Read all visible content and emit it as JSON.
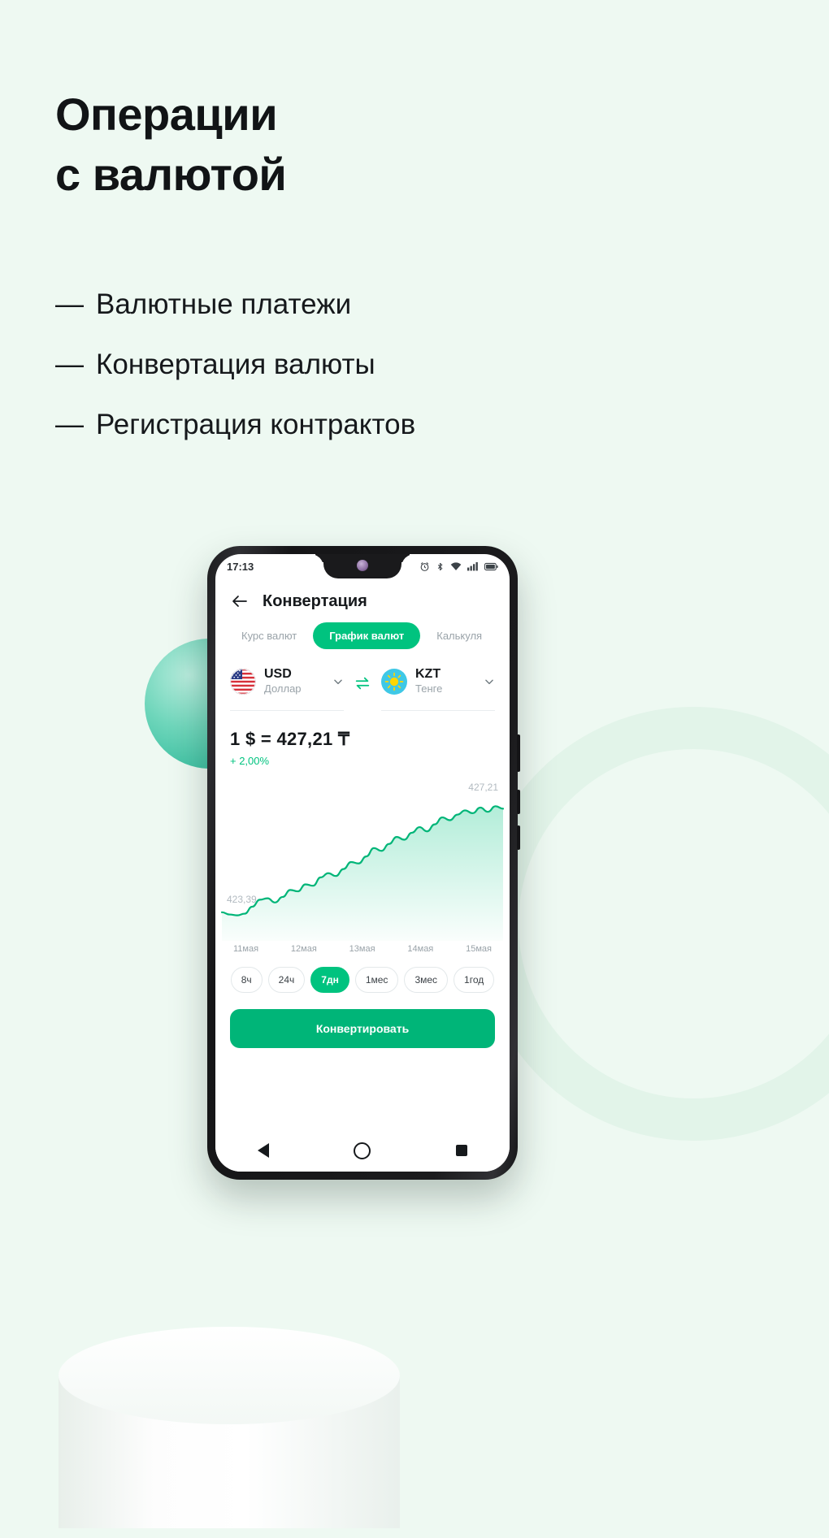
{
  "page": {
    "background_color": "#eef9f2",
    "accent_color": "#00c37f"
  },
  "headline": {
    "line1": "Операции",
    "line2": "с валютой"
  },
  "bullets": [
    {
      "dash": "—",
      "label": "Валютные платежи"
    },
    {
      "dash": "—",
      "label": "Конвертация валюты"
    },
    {
      "dash": "—",
      "label": "Регистрация контрактов"
    }
  ],
  "phone": {
    "status_bar": {
      "time": "17:13",
      "icons": [
        "alarm-icon",
        "bluetooth-icon",
        "wifi-icon",
        "signal-icon",
        "battery-icon"
      ]
    },
    "header": {
      "back_icon": "back-arrow-icon",
      "title": "Конвертация"
    },
    "tabs": [
      {
        "label": "Курс валют",
        "active": false
      },
      {
        "label": "График валют",
        "active": true
      },
      {
        "label": "Калькуля",
        "active": false
      }
    ],
    "converter": {
      "from": {
        "code": "USD",
        "name": "Доллар",
        "flag": "flag-usa-icon"
      },
      "to": {
        "code": "KZT",
        "name": "Тенге",
        "flag": "flag-kazakhstan-icon"
      },
      "swap_icon": "swap-arrows-icon",
      "chevron_icon": "chevron-down-icon"
    },
    "rate": {
      "value": "1 $  =  427,21 ₸",
      "delta": "+ 2,00%",
      "delta_color": "#00c37f"
    },
    "dates": [
      "11мая",
      "12мая",
      "13мая",
      "14мая",
      "15мая"
    ],
    "periods": [
      {
        "label": "8ч",
        "active": false
      },
      {
        "label": "24ч",
        "active": false
      },
      {
        "label": "7дн",
        "active": true
      },
      {
        "label": "1мес",
        "active": false
      },
      {
        "label": "3мес",
        "active": false
      },
      {
        "label": "1год",
        "active": false
      }
    ],
    "cta": {
      "label": "Конвертировать"
    },
    "nav": [
      "nav-back-icon",
      "nav-home-icon",
      "nav-recents-icon"
    ]
  },
  "chart_data": {
    "type": "area",
    "title": "",
    "xlabel": "",
    "ylabel": "",
    "label_low": "423,39",
    "label_high": "427,21",
    "ylim": [
      423.0,
      427.6
    ],
    "grid": false,
    "legend": "none",
    "line_color": "#00b578",
    "fill_color": "rgba(0,195,127,0.16)",
    "categories": [
      "11мая",
      "12мая",
      "13мая",
      "14мая",
      "15мая"
    ],
    "values": [
      423.5,
      423.42,
      423.39,
      423.45,
      423.7,
      423.95,
      424.0,
      423.85,
      424.05,
      424.3,
      424.25,
      424.5,
      424.45,
      424.75,
      424.9,
      424.8,
      425.05,
      425.3,
      425.25,
      425.5,
      425.8,
      425.7,
      425.95,
      426.2,
      426.1,
      426.35,
      426.55,
      426.4,
      426.65,
      426.9,
      426.8,
      427.0,
      427.15,
      427.05,
      427.25,
      427.1,
      427.3,
      427.21
    ]
  }
}
